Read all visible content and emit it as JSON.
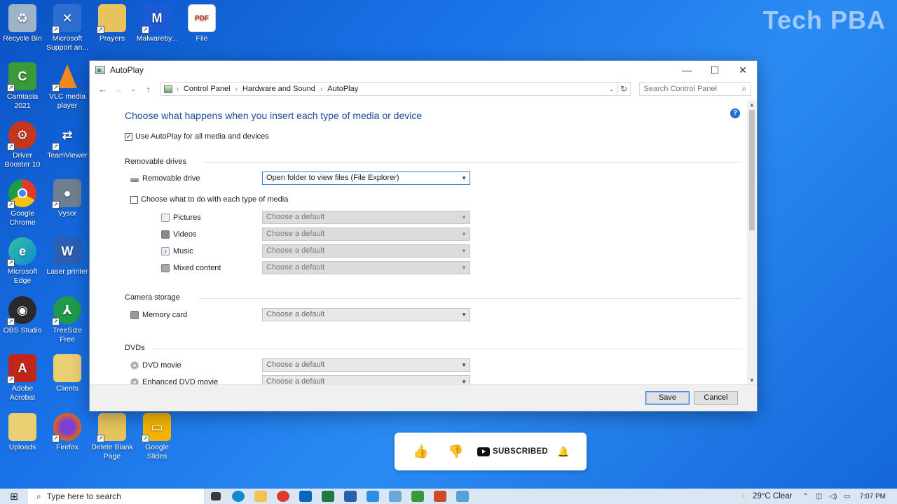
{
  "watermark": "Tech PBA",
  "desktop_icons": [
    {
      "label": "Recycle Bin",
      "icon": "recycle-bin-icon",
      "color": "#9fb3c8"
    },
    {
      "label": "Microsoft Support an...",
      "icon": "wrench-icon",
      "color": "#2d6fcf"
    },
    {
      "label": "Prayers",
      "icon": "folder-doc-icon",
      "color": "#e7c45b"
    },
    {
      "label": "Malwareby...",
      "icon": "malwarebytes-icon",
      "color": "#1d5bd6"
    },
    {
      "label": "File",
      "icon": "pdf-icon",
      "color": "#ffffff"
    },
    {
      "label": "Camtasia 2021",
      "icon": "camtasia-icon",
      "color": "#3a9a3a"
    },
    {
      "label": "VLC media player",
      "icon": "vlc-cone-icon",
      "color": "#f08a1c"
    },
    {
      "label": "Driver Booster 10",
      "icon": "driver-booster-icon",
      "color": "#c8351d"
    },
    {
      "label": "TeamViewer",
      "icon": "teamviewer-icon",
      "color": "#0e5fd8"
    },
    {
      "label": "Google Chrome",
      "icon": "chrome-icon",
      "color": "#e0392b"
    },
    {
      "label": "Vysor",
      "icon": "vysor-icon",
      "color": "#6f7f8f"
    },
    {
      "label": "Microsoft Edge",
      "icon": "edge-icon",
      "color": "#0f8ad1"
    },
    {
      "label": "Laser printer",
      "icon": "word-doc-icon",
      "color": "#2b5fb3"
    },
    {
      "label": "OBS Studio",
      "icon": "obs-icon",
      "color": "#2a2a2a"
    },
    {
      "label": "TreeSize Free",
      "icon": "treesize-icon",
      "color": "#1e9a4a"
    },
    {
      "label": "Adobe Acrobat",
      "icon": "acrobat-icon",
      "color": "#c1261b"
    },
    {
      "label": "Clients",
      "icon": "folder-icon",
      "color": "#e9cf72"
    },
    {
      "label": "Uploads",
      "icon": "folder-icon",
      "color": "#e9cf72"
    },
    {
      "label": "Firefox",
      "icon": "firefox-icon",
      "color": "#e8650c"
    },
    {
      "label": "Delete Blank Page",
      "icon": "folder-doc-icon",
      "color": "#e7c45b"
    },
    {
      "label": "Google Slides",
      "icon": "slides-icon",
      "color": "#f4b400"
    }
  ],
  "window": {
    "title": "AutoPlay",
    "controls": {
      "minimize": "—",
      "maximize": "☐",
      "close": "✕"
    },
    "breadcrumb": [
      "Control Panel",
      "Hardware and Sound",
      "AutoPlay"
    ],
    "search_placeholder": "Search Control Panel",
    "heading": "Choose what happens when you insert each type of media or device",
    "use_autoplay_label": "Use AutoPlay for all media and devices",
    "use_autoplay_checked": "✓",
    "sections": {
      "removable": {
        "title": "Removable drives",
        "drive_label": "Removable drive",
        "drive_value": "Open folder to view files (File Explorer)",
        "each_type_label": "Choose what to do with each type of media",
        "media": [
          {
            "label": "Pictures",
            "value": "Choose a default"
          },
          {
            "label": "Videos",
            "value": "Choose a default"
          },
          {
            "label": "Music",
            "value": "Choose a default"
          },
          {
            "label": "Mixed content",
            "value": "Choose a default"
          }
        ]
      },
      "camera": {
        "title": "Camera storage",
        "label": "Memory card",
        "value": "Choose a default"
      },
      "dvds": {
        "title": "DVDs",
        "items": [
          {
            "label": "DVD movie",
            "value": "Choose a default"
          },
          {
            "label": "Enhanced DVD movie",
            "value": "Choose a default"
          }
        ]
      }
    },
    "save_label": "Save",
    "cancel_label": "Cancel"
  },
  "subscribe_bar": {
    "text": "SUBSCRIBED"
  },
  "taskbar": {
    "search_placeholder": "Type here to search",
    "weather": "29°C  Clear",
    "time": "7:07 PM",
    "apps": [
      {
        "icon": "task-view-icon",
        "color": "#3a3a3a"
      },
      {
        "icon": "edge-icon",
        "color": "#0f8ad1"
      },
      {
        "icon": "file-explorer-icon",
        "color": "#f2c14e"
      },
      {
        "icon": "chrome-icon",
        "color": "#e0392b"
      },
      {
        "icon": "outlook-icon",
        "color": "#0a64c2"
      },
      {
        "icon": "excel-icon",
        "color": "#1d7a44"
      },
      {
        "icon": "word-icon",
        "color": "#2b5fb3"
      },
      {
        "icon": "store-icon",
        "color": "#2c8fe0"
      },
      {
        "icon": "paint-icon",
        "color": "#6ba8d8"
      },
      {
        "icon": "camtasia-icon",
        "color": "#3a9a3a"
      },
      {
        "icon": "powerpoint-icon",
        "color": "#d04a27"
      },
      {
        "icon": "control-panel-icon",
        "color": "#5aa0d8"
      }
    ]
  },
  "colors": {
    "accent": "#1a4d9e",
    "desktop": "#1a73e8",
    "subscribe_like": "#1e73e8",
    "bell": "#f5c400"
  }
}
